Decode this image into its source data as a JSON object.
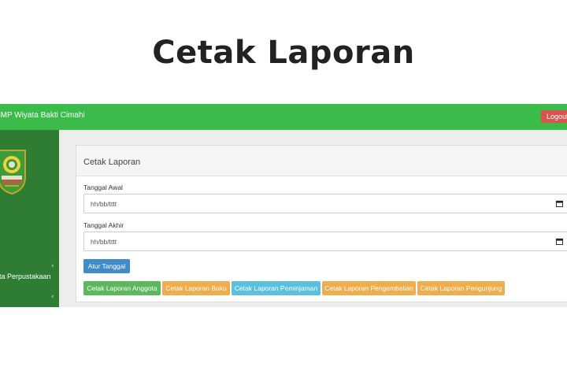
{
  "slide": {
    "title": "Cetak Laporan"
  },
  "topbar": {
    "brand": "SMP Wiyata Bakti Cimahi",
    "logout_label": "Logout",
    "logout_color": "#d9534f",
    "bar_color": "#3bbb4a"
  },
  "sidebar": {
    "items": [
      {
        "label": "ota Perpustakaan"
      },
      {
        "label": ""
      }
    ],
    "bg_color": "#2e7d32"
  },
  "panel": {
    "title": "Cetak Laporan",
    "start_label": "Tanggal Awal",
    "start_value": "hh/bb/tttt",
    "end_label": "Tanggal Akhir",
    "end_value": "hh/bb/tttt",
    "set_date_button": "Atur Tanggal"
  },
  "report_buttons": [
    {
      "label": "Cetak Laporan Anggota",
      "color": "#5cb85c"
    },
    {
      "label": "Cetak Laporan Buku",
      "color": "#f0ad4e"
    },
    {
      "label": "Cetak Laporan Peminjaman",
      "color": "#5bc0de"
    },
    {
      "label": "Cetak Laporan Pengembalian",
      "color": "#f0ad4e"
    },
    {
      "label": "Cetak Laporan Pengunjung",
      "color": "#f0ad4e"
    }
  ]
}
